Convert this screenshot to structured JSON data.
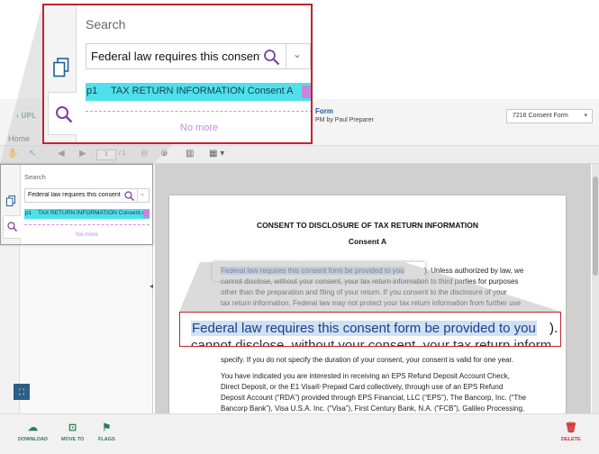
{
  "header": {
    "back_label": "UPL",
    "doc_title": "Form",
    "doc_meta": "PM by Paul Preparer",
    "form_select": "7216 Consent Form",
    "home": "Home"
  },
  "toolbar": {
    "page_current": "1",
    "page_total": "/ 1"
  },
  "search_panel": {
    "title": "Search",
    "query": "Federal law requires this consent",
    "result_page": "p1",
    "result_text": "TAX RETURN INFORMATION Consent A",
    "no_more": "No more"
  },
  "document": {
    "heading": "CONSENT TO DISCLOSURE OF TAX RETURN INFORMATION",
    "subheading": "Consent A",
    "highlight": "Federal law requires this consent form be provided to you",
    "lines": [
      "). Unless authorized by law, we",
      "cannot disclose, without your consent, your tax return information to third parties for purposes",
      "other than the preparation and filing of your return. If you consent to the disclosure of your",
      "tax return information, Federal law may not protect your tax return information from further use",
      "specify. If you do not specify the duration of your consent, your consent is valid for one year.",
      "You have indicated you are interested in receiving an EPS Refund Deposit Account Check,",
      "Direct Deposit, or the E1 Visa® Prepaid Card collectively, through use of an EPS Refund",
      "Deposit Account (“RDA”) provided through EPS Financial, LLC (“EPS”), The Bancorp, Inc. (“The",
      "Bancorp Bank”), Visa U.S.A. Inc. (“Visa”), First Century Bank, N.A. (“FCB”), Galileo Processing,"
    ],
    "zoom_tail": ").",
    "zoom_line2": "cannot disclose, without your consent, your tax return inform"
  },
  "footer": {
    "download": "DOWNLOAD",
    "move_to": "MOVE TO",
    "flags": "FLAGS",
    "delete": "DELETE"
  },
  "colors": {
    "accent_green": "#2e7d4f",
    "magnifier_border": "#c2242d",
    "result_highlight": "#4ee1ea",
    "result_mark": "#c885e0",
    "text_highlight": "#cfe1f3",
    "delete_red": "#d32f2f"
  },
  "icons": {
    "back": "chevron-left-icon",
    "hand": "hand-tool-icon",
    "search": "magnifier-icon",
    "documents": "documents-icon",
    "download": "cloud-download-icon",
    "move_to": "move-to-icon",
    "flags": "flag-icon",
    "delete": "trash-icon",
    "fit": "fit-screen-icon"
  }
}
